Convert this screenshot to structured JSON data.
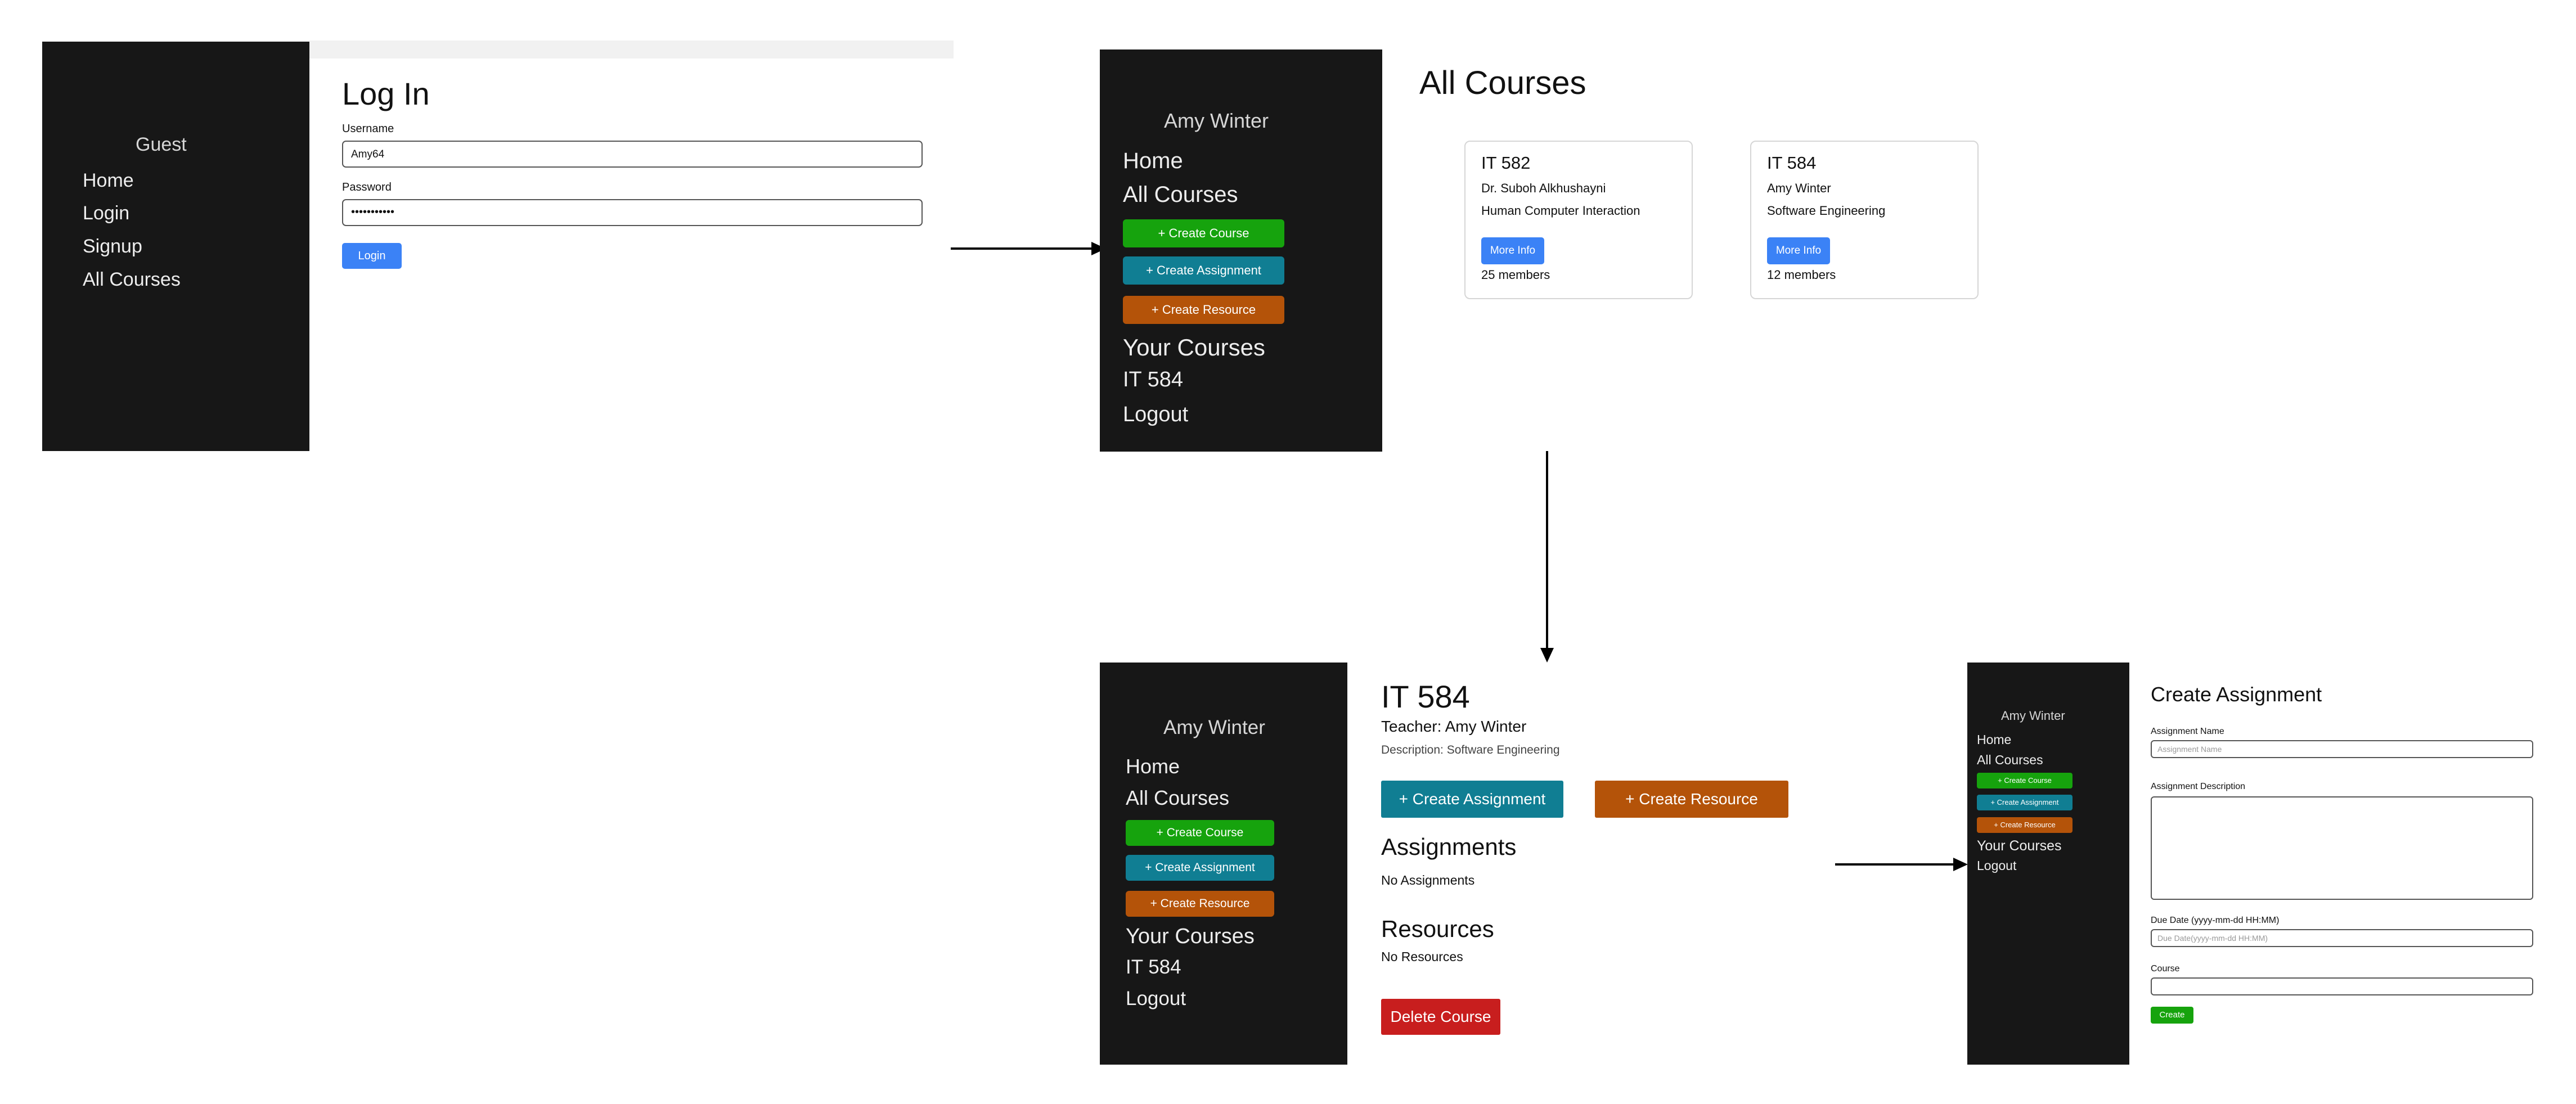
{
  "login": {
    "sidebar": {
      "user": "Guest",
      "links": [
        "Home",
        "Login",
        "Signup",
        "All Courses"
      ]
    },
    "title": "Log In",
    "username_label": "Username",
    "username_value": "Amy64",
    "password_label": "Password",
    "password_value": "•••••••••••",
    "login_button": "Login"
  },
  "courses": {
    "sidebar": {
      "user": "Amy Winter",
      "home": "Home",
      "all_courses": "All Courses",
      "create_course": "+ Create Course",
      "create_assignment": "+ Create Assignment",
      "create_resource": "+ Create Resource",
      "your_courses": "Your Courses",
      "course_link": "IT 584",
      "logout": "Logout"
    },
    "title": "All Courses",
    "cards": [
      {
        "code": "IT 582",
        "teacher": "Dr. Suboh Alkhushayni",
        "name": "Human Computer Interaction",
        "button": "More Info",
        "members": "25 members"
      },
      {
        "code": "IT 584",
        "teacher": "Amy Winter",
        "name": "Software Engineering",
        "button": "More Info",
        "members": "12 members"
      }
    ]
  },
  "course_detail": {
    "sidebar": {
      "user": "Amy Winter",
      "home": "Home",
      "all_courses": "All Courses",
      "create_course": "+ Create Course",
      "create_assignment": "+ Create Assignment",
      "create_resource": "+ Create Resource",
      "your_courses": "Your Courses",
      "course_link": "IT 584",
      "logout": "Logout"
    },
    "title": "IT 584",
    "teacher": "Teacher: Amy Winter",
    "description": "Description: Software Engineering",
    "create_assignment_button": "+ Create Assignment",
    "create_resource_button": "+ Create Resource",
    "assignments_heading": "Assignments",
    "assignments_empty": "No Assignments",
    "resources_heading": "Resources",
    "resources_empty": "No Resources",
    "delete_button": "Delete Course"
  },
  "create_assignment": {
    "sidebar": {
      "user": "Amy Winter",
      "home": "Home",
      "all_courses": "All Courses",
      "create_course": "+ Create Course",
      "create_assignment": "+ Create Assignment",
      "create_resource": "+ Create Resource",
      "your_courses": "Your Courses",
      "logout": "Logout"
    },
    "title": "Create Assignment",
    "name_label": "Assignment Name",
    "name_placeholder": "Assignment Name",
    "description_label": "Assignment Description",
    "due_label": "Due Date (yyyy-mm-dd HH:MM)",
    "due_placeholder": "Due Date(yyyy-mm-dd HH:MM)",
    "course_label": "Course",
    "create_button": "Create"
  },
  "colors": {
    "sidebar_bg": "#171717",
    "green": "#16a30d",
    "teal": "#107e93",
    "orange": "#b45309",
    "red": "#c81e1e",
    "blue": "#3b82f6"
  }
}
